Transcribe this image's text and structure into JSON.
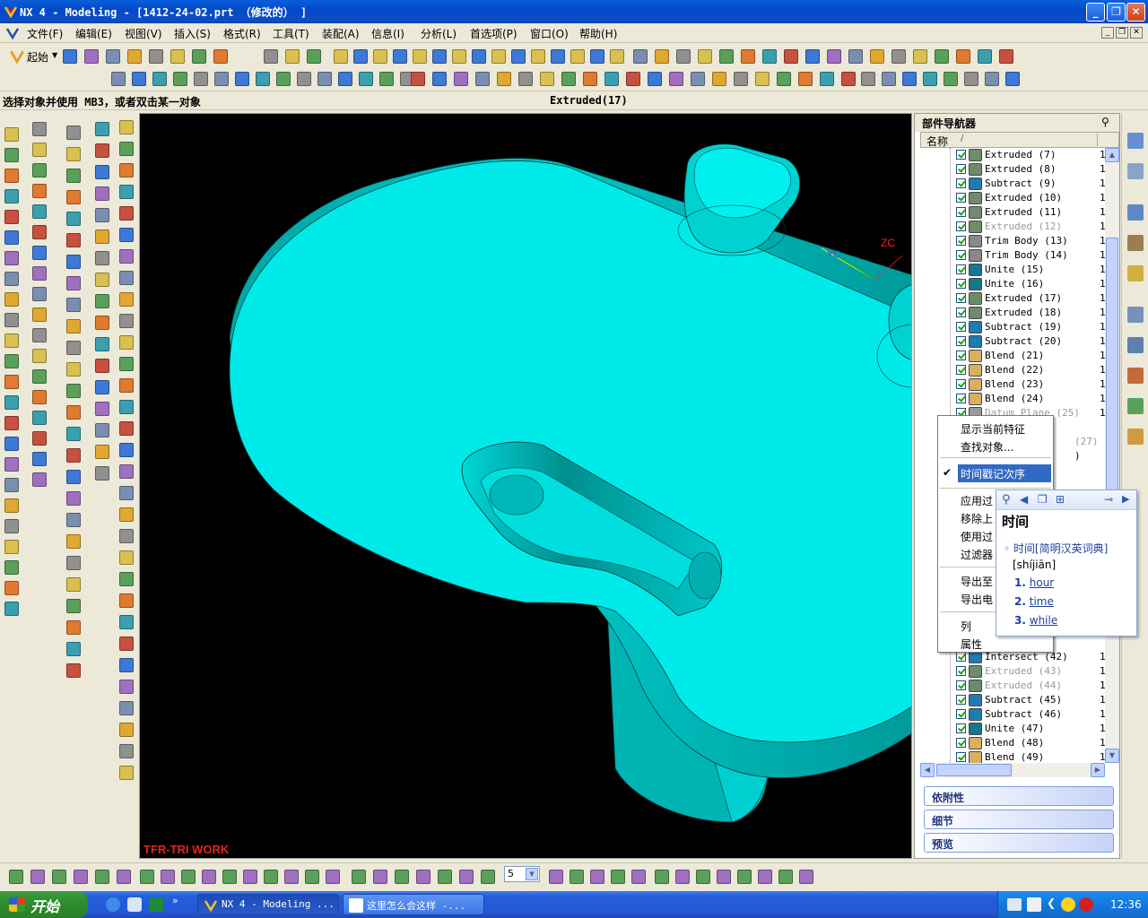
{
  "window": {
    "title": "NX 4 - Modeling - [1412-24-02.prt （修改的） ]",
    "minimize": "_",
    "maximize": "❐",
    "close": "✕"
  },
  "menubar": {
    "items": [
      "文件(F)",
      "编辑(E)",
      "视图(V)",
      "插入(S)",
      "格式(R)",
      "工具(T)",
      "装配(A)",
      "信息(I)",
      "分析(L)",
      "首选项(P)",
      "窗口(O)",
      "帮助(H)"
    ],
    "start_label": "起始"
  },
  "status": {
    "prompt": "选择对象并使用 MB3，或者双击某一对象",
    "selection": "Extruded(17)"
  },
  "graphics": {
    "watermark": "TFR-TRI WORK",
    "axis_zc": "ZC",
    "axis_yc": "YC",
    "model_color": "#00e8e8",
    "background": "#000000"
  },
  "navigator": {
    "title": "部件导航器",
    "column_name": "名称",
    "features": [
      {
        "label": "Extruded  (7)",
        "icon": "extrude-icon",
        "state": "active"
      },
      {
        "label": "Extruded  (8)",
        "icon": "extrude-icon",
        "state": "active"
      },
      {
        "label": "Subtract  (9)",
        "icon": "subtract-icon",
        "state": "active"
      },
      {
        "label": "Extruded  (10)",
        "icon": "extrude-icon",
        "state": "active"
      },
      {
        "label": "Extruded  (11)",
        "icon": "extrude-icon",
        "state": "active"
      },
      {
        "label": "Extruded  (12)",
        "icon": "extrude-icon",
        "state": "suppressed"
      },
      {
        "label": "Trim Body  (13)",
        "icon": "trim-body-icon",
        "state": "active"
      },
      {
        "label": "Trim Body  (14)",
        "icon": "trim-body-icon",
        "state": "active"
      },
      {
        "label": "Unite  (15)",
        "icon": "unite-icon",
        "state": "active"
      },
      {
        "label": "Unite  (16)",
        "icon": "unite-icon",
        "state": "active"
      },
      {
        "label": "Extruded  (17)",
        "icon": "extrude-icon",
        "state": "active"
      },
      {
        "label": "Extruded  (18)",
        "icon": "extrude-icon",
        "state": "active"
      },
      {
        "label": "Subtract  (19)",
        "icon": "subtract-icon",
        "state": "active"
      },
      {
        "label": "Subtract  (20)",
        "icon": "subtract-icon",
        "state": "active"
      },
      {
        "label": "Blend  (21)",
        "icon": "blend-icon",
        "state": "active"
      },
      {
        "label": "Blend  (22)",
        "icon": "blend-icon",
        "state": "active"
      },
      {
        "label": "Blend  (23)",
        "icon": "blend-icon",
        "state": "active"
      },
      {
        "label": "Blend  (24)",
        "icon": "blend-icon",
        "state": "active"
      },
      {
        "label": "Datum Plane  (25)",
        "icon": "datum-plane-icon",
        "state": "suppressed"
      }
    ],
    "hidden_partial_1": "(27)",
    "hidden_partial_2": ")",
    "features_lower": [
      {
        "label": "Intersect  (42)",
        "icon": "intersect-icon",
        "state": "active"
      },
      {
        "label": "Extruded  (43)",
        "icon": "extrude-icon",
        "state": "suppressed"
      },
      {
        "label": "Extruded  (44)",
        "icon": "extrude-icon",
        "state": "suppressed"
      },
      {
        "label": "Subtract  (45)",
        "icon": "subtract-icon",
        "state": "active"
      },
      {
        "label": "Subtract  (46)",
        "icon": "subtract-icon",
        "state": "active"
      },
      {
        "label": "Unite  (47)",
        "icon": "unite-icon",
        "state": "active"
      },
      {
        "label": "Blend  (48)",
        "icon": "blend-icon",
        "state": "active"
      },
      {
        "label": "Blend  (49)",
        "icon": "blend-icon",
        "state": "active"
      }
    ],
    "sections": [
      "依附性",
      "细节",
      "预览"
    ]
  },
  "context_menu": {
    "items": [
      "显示当前特征",
      "查找对象...",
      "时间戳记次序",
      "应用过",
      "移除上",
      "使用过",
      "过滤器",
      "导出至",
      "导出电",
      "列",
      "属性"
    ],
    "checked_item": "时间戳记次序"
  },
  "dictionary": {
    "word": "时间",
    "source": "时间[简明汉英词典]",
    "pinyin": "[shíjiān]",
    "meanings": [
      {
        "num": "1.",
        "word": "hour"
      },
      {
        "num": "2.",
        "word": "time"
      },
      {
        "num": "3.",
        "word": "while"
      }
    ]
  },
  "bottombar": {
    "layer_value": "5"
  },
  "taskbar": {
    "start": "开始",
    "tasks": [
      "NX 4 - Modeling ...",
      "这里怎么会这样 -..."
    ],
    "clock": "12:36"
  }
}
